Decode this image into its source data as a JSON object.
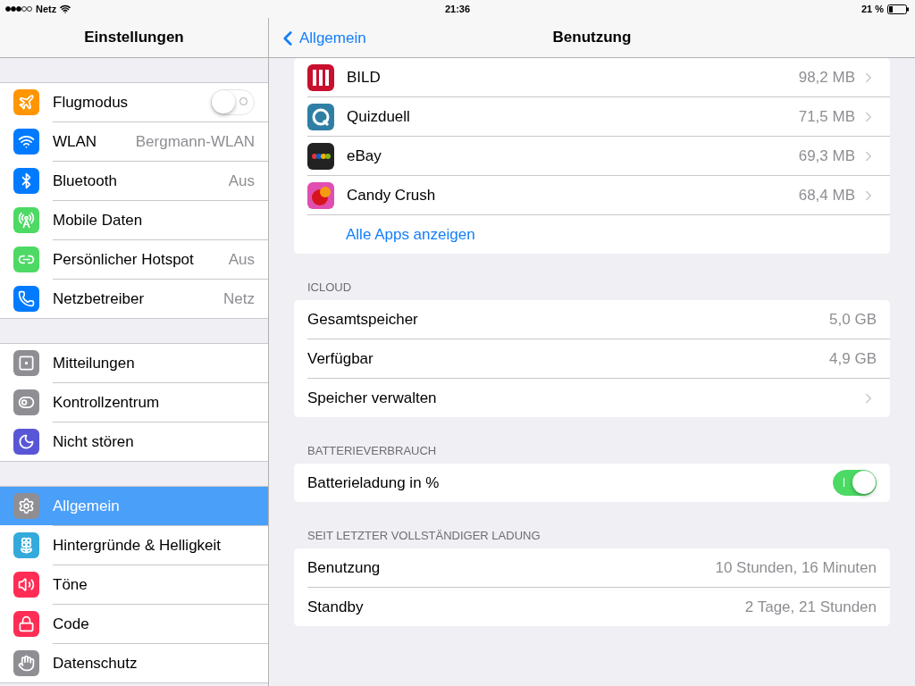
{
  "status_bar": {
    "carrier": "Netz",
    "time": "21:36",
    "battery": "21 %"
  },
  "sidebar": {
    "title": "Einstellungen",
    "groups": [
      {
        "items": [
          {
            "label": "Flugmodus",
            "kind": "toggle",
            "on": false,
            "selected": false
          },
          {
            "label": "WLAN",
            "value": "Bergmann-WLAN",
            "kind": "detail",
            "selected": false
          },
          {
            "label": "Bluetooth",
            "value": "Aus",
            "kind": "detail",
            "selected": false
          },
          {
            "label": "Mobile Daten",
            "kind": "detail",
            "selected": false
          },
          {
            "label": "Persönlicher Hotspot",
            "value": "Aus",
            "kind": "detail",
            "selected": false
          },
          {
            "label": "Netzbetreiber",
            "value": "Netz",
            "kind": "detail",
            "selected": false
          }
        ]
      },
      {
        "items": [
          {
            "label": "Mitteilungen",
            "kind": "detail",
            "selected": false
          },
          {
            "label": "Kontrollzentrum",
            "kind": "detail",
            "selected": false
          },
          {
            "label": "Nicht stören",
            "kind": "detail",
            "selected": false
          }
        ]
      },
      {
        "items": [
          {
            "label": "Allgemein",
            "kind": "detail",
            "selected": true
          },
          {
            "label": "Hintergründe & Helligkeit",
            "kind": "detail",
            "selected": false
          },
          {
            "label": "Töne",
            "kind": "detail",
            "selected": false
          },
          {
            "label": "Code",
            "kind": "detail",
            "selected": false
          },
          {
            "label": "Datenschutz",
            "kind": "detail",
            "selected": false
          }
        ]
      }
    ]
  },
  "detail": {
    "back": "Allgemein",
    "title": "Benutzung",
    "apps": [
      {
        "name": "BILD",
        "size": "98,2 MB"
      },
      {
        "name": "Quizduell",
        "size": "71,5 MB"
      },
      {
        "name": "eBay",
        "size": "69,3 MB"
      },
      {
        "name": "Candy Crush",
        "size": "68,4 MB"
      }
    ],
    "show_all": "Alle Apps anzeigen",
    "sections": [
      {
        "header": "ICLOUD",
        "rows": [
          {
            "label": "Gesamtspeicher",
            "value": "5,0 GB",
            "kind": "value"
          },
          {
            "label": "Verfügbar",
            "value": "4,9 GB",
            "kind": "value"
          },
          {
            "label": "Speicher verwalten",
            "kind": "disclosure"
          }
        ]
      },
      {
        "header": "BATTERIEVERBRAUCH",
        "rows": [
          {
            "label": "Batterieladung in %",
            "kind": "toggle",
            "on": true
          }
        ]
      },
      {
        "header": "SEIT LETZTER VOLLSTÄNDIGER LADUNG",
        "rows": [
          {
            "label": "Benutzung",
            "value": "10 Stunden, 16 Minuten",
            "kind": "value"
          },
          {
            "label": "Standby",
            "value": "2 Tage, 21 Stunden",
            "kind": "value"
          }
        ]
      }
    ]
  }
}
